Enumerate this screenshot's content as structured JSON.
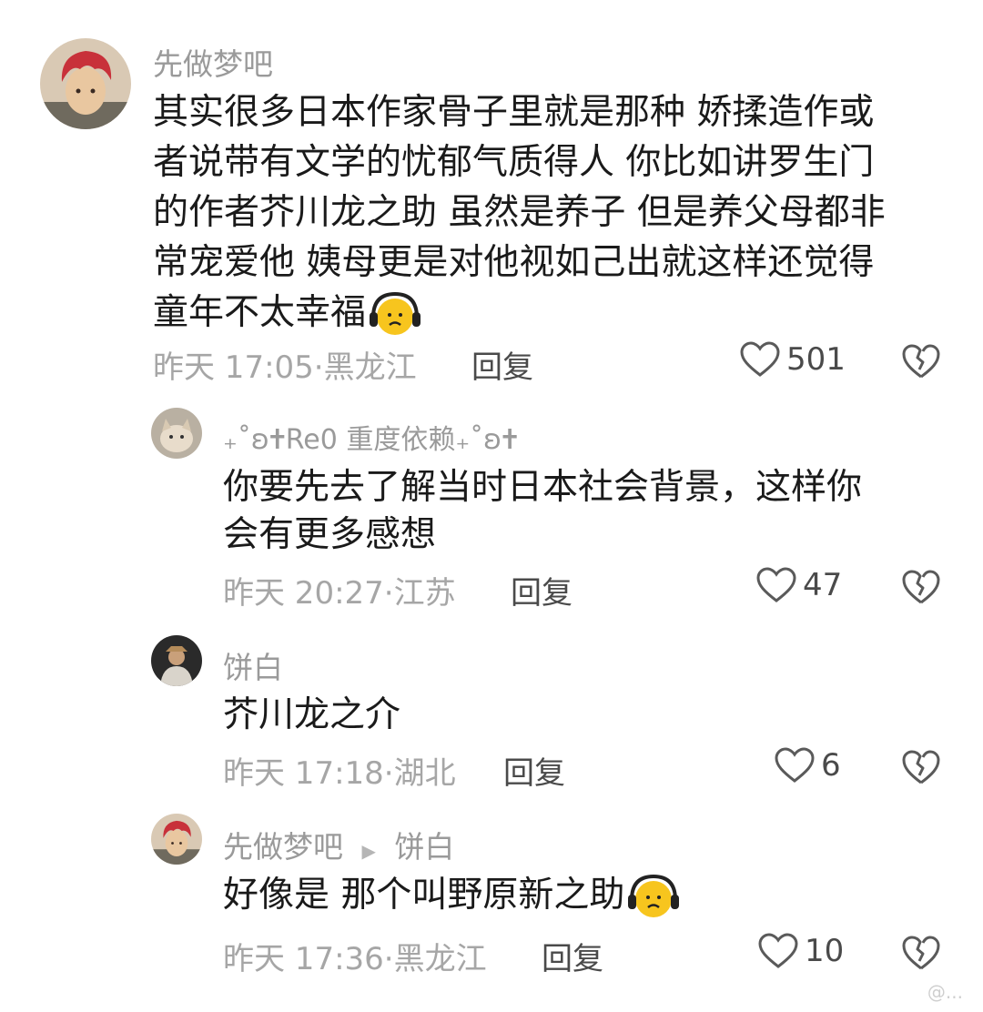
{
  "comments": [
    {
      "user": "先做梦吧",
      "avatar_icon": "red-hair-avatar-icon",
      "text_lines": [
        "其实很多日本作家骨子里就是那种 娇揉造作或",
        "者说带有文学的忧郁气质得人 你比如讲罗生门",
        "的作者芥川龙之助 虽然是养子 但是养父母都非",
        "常宠爱他 姨母更是对他视如己出就这样还觉得",
        "童年不太幸福"
      ],
      "emoji": "headphone-sad-emoji-icon",
      "time": "昨天 17:05",
      "location": "黑龙江",
      "reply_label": "回复",
      "likes": "501"
    },
    {
      "user": "₊˚ʚ🕇Re0 重度依赖₊˚ʚ🕇",
      "avatar_icon": "cat-avatar-icon",
      "text_lines": [
        "你要先去了解当时日本社会背景，这样你",
        "会有更多感想"
      ],
      "time": "昨天 20:27",
      "location": "江苏",
      "reply_label": "回复",
      "likes": "47"
    },
    {
      "user": "饼白",
      "avatar_icon": "person-avatar-icon",
      "text_lines": [
        "芥川龙之介"
      ],
      "time": "昨天 17:18",
      "location": "湖北",
      "reply_label": "回复",
      "likes": "6"
    },
    {
      "user": "先做梦吧",
      "reply_to": "饼白",
      "avatar_icon": "red-hair-avatar-icon",
      "text_lines": [
        "好像是 那个叫野原新之助"
      ],
      "emoji": "headphone-sad-emoji-icon",
      "time": "昨天 17:36",
      "location": "黑龙江",
      "reply_label": "回复",
      "likes": "10"
    }
  ],
  "watermark": "@...",
  "colors": {
    "like_stroke": "#5a5a5a",
    "meta": "#a6a6a6",
    "name": "#9a9a9a"
  }
}
